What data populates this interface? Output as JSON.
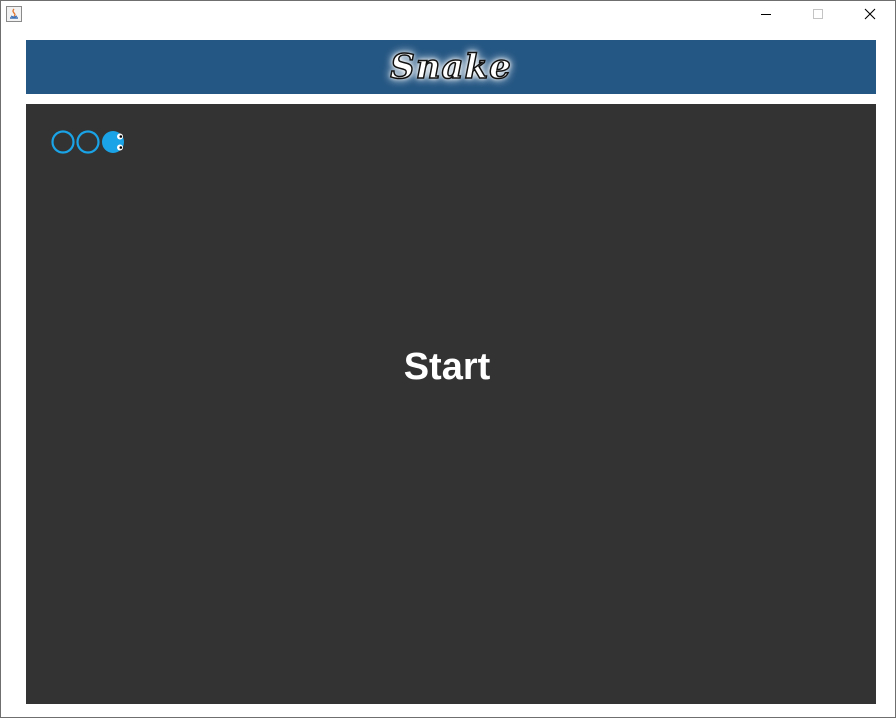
{
  "window": {
    "controls": {
      "minimize": "minimize-icon",
      "maximize": "maximize-icon",
      "close": "close-icon"
    }
  },
  "header": {
    "title": "Snake"
  },
  "game": {
    "start_label": "Start",
    "snake": {
      "body_segments": 2,
      "head_count": 1,
      "direction": "right",
      "color": "#1aa3e6"
    },
    "colors": {
      "board": "#333333",
      "banner": "#255784",
      "text": "#ffffff"
    }
  }
}
